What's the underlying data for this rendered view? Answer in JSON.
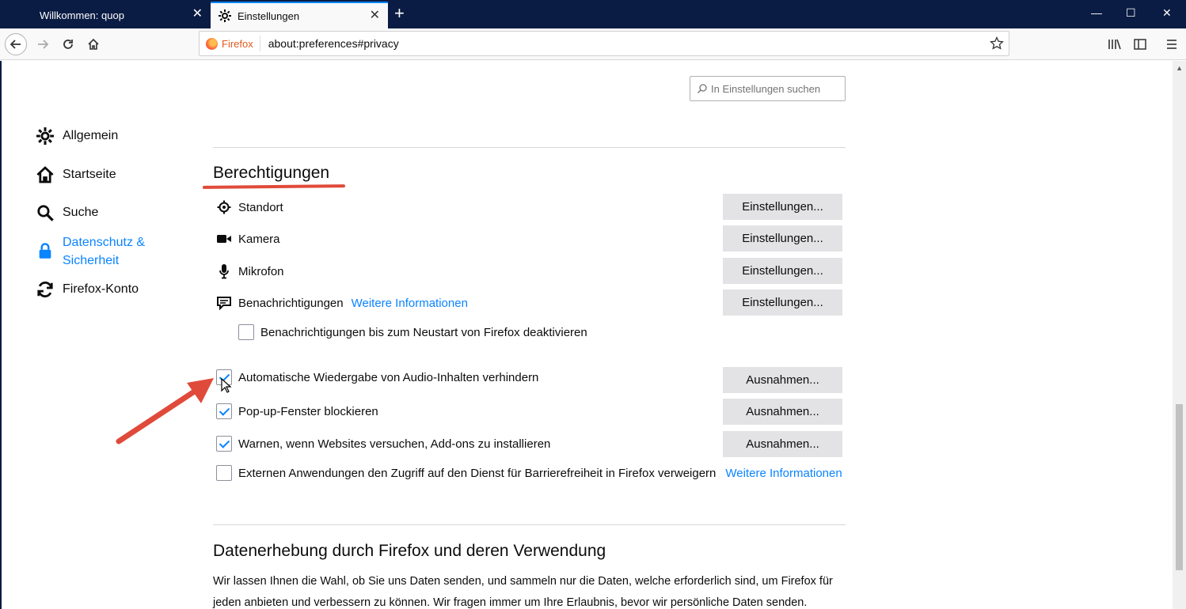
{
  "tabs": [
    {
      "title": "Willkommen: quop",
      "active": false
    },
    {
      "title": "Einstellungen",
      "active": true
    }
  ],
  "toolbar": {
    "brand": "Firefox",
    "url": "about:preferences#privacy"
  },
  "search": {
    "placeholder": "In Einstellungen suchen"
  },
  "sidebar": {
    "items": [
      {
        "label": "Allgemein",
        "icon": "gear-icon"
      },
      {
        "label": "Startseite",
        "icon": "home-icon"
      },
      {
        "label": "Suche",
        "icon": "search-icon"
      },
      {
        "label": "Datenschutz &",
        "label2": "Sicherheit",
        "icon": "lock-icon",
        "selected": true
      },
      {
        "label": "Firefox-Konto",
        "icon": "sync-icon"
      }
    ]
  },
  "permissions": {
    "heading": "Berechtigungen",
    "rows": [
      {
        "label": "Standort",
        "icon": "location-icon",
        "button": "Einstellungen..."
      },
      {
        "label": "Kamera",
        "icon": "camera-icon",
        "button": "Einstellungen..."
      },
      {
        "label": "Mikrofon",
        "icon": "microphone-icon",
        "button": "Einstellungen..."
      },
      {
        "label": "Benachrichtigungen",
        "icon": "notification-icon",
        "link": "Weitere Informationen",
        "button": "Einstellungen..."
      }
    ],
    "pause_notifications": {
      "label": "Benachrichtigungen bis zum Neustart von Firefox deaktivieren",
      "checked": false
    },
    "checkboxes": [
      {
        "label": "Automatische Wiedergabe von Audio-Inhalten verhindern",
        "checked": true,
        "button": "Ausnahmen..."
      },
      {
        "label": "Pop-up-Fenster blockieren",
        "checked": true,
        "button": "Ausnahmen..."
      },
      {
        "label": "Warnen, wenn Websites versuchen, Add-ons zu installieren",
        "checked": true,
        "button": "Ausnahmen..."
      },
      {
        "label": "Externen Anwendungen den Zugriff auf den Dienst für Barrierefreiheit in Firefox verweigern",
        "checked": false,
        "link": "Weitere Informationen"
      }
    ]
  },
  "data_collection": {
    "heading": "Datenerhebung durch Firefox und deren Verwendung",
    "paragraph": "Wir lassen Ihnen die Wahl, ob Sie uns Daten senden, und sammeln nur die Daten, welche erforderlich sind, um Firefox für jeden anbieten und verbessern zu können. Wir fragen immer um Ihre Erlaubnis, bevor wir persönliche Daten senden."
  },
  "colors": {
    "accent": "#0a84ff",
    "annotation": "#e04a3a",
    "titlebar": "#0a1c43"
  }
}
